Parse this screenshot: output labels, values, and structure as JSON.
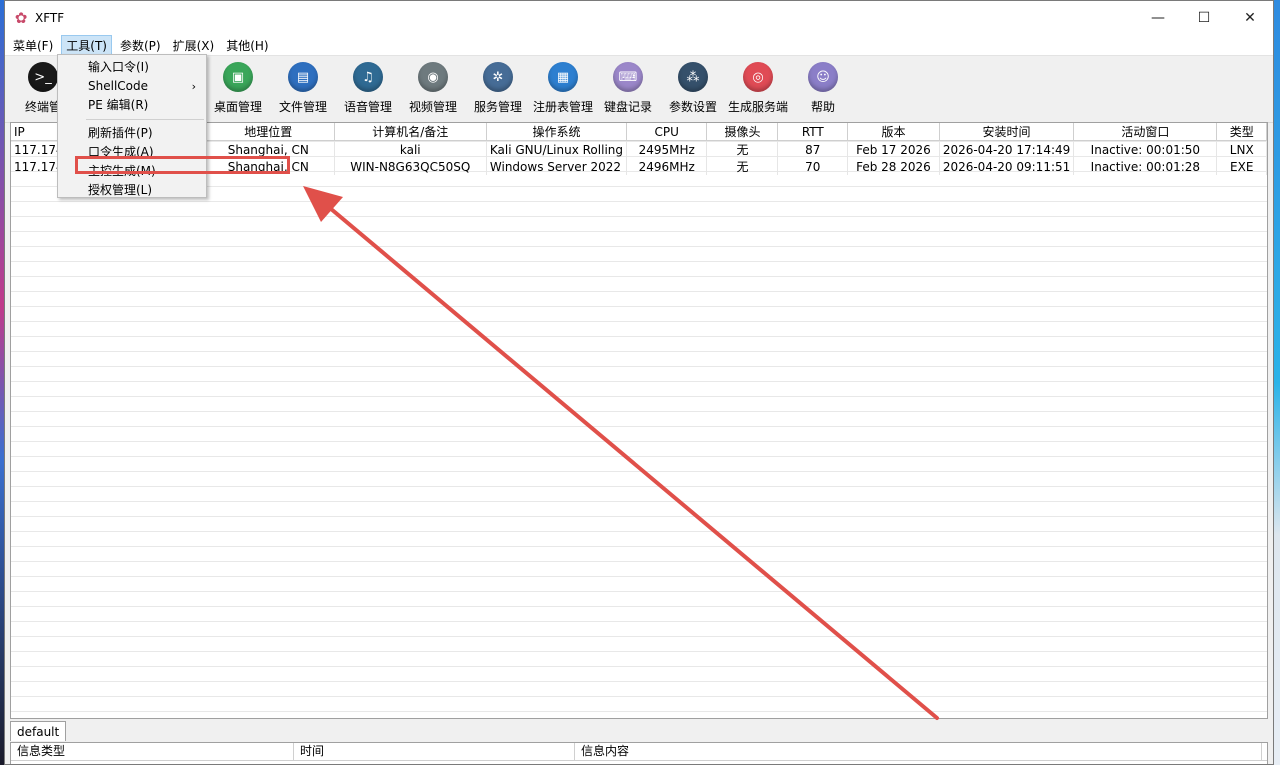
{
  "window": {
    "title": "XFTF",
    "controls": [
      "—",
      "☐",
      "✕"
    ]
  },
  "menubar": [
    "菜单(F)",
    "工具(T)",
    "参数(P)",
    "扩展(X)",
    "其他(H)"
  ],
  "toolbar": [
    {
      "label": "终端管",
      "icon": "terminal-icon",
      "color": "#1a1a1a",
      "glyph": ">_"
    },
    {
      "label": "桌面管理",
      "icon": "desktop-icon",
      "color": "#3aa65a",
      "glyph": "▣"
    },
    {
      "label": "文件管理",
      "icon": "file-icon",
      "color": "#2e6fbf",
      "glyph": "▤"
    },
    {
      "label": "语音管理",
      "icon": "audio-icon",
      "color": "#2f6a93",
      "glyph": "♫"
    },
    {
      "label": "视频管理",
      "icon": "camera-icon",
      "color": "#6e7a7e",
      "glyph": "◉"
    },
    {
      "label": "服务管理",
      "icon": "gear-icon",
      "color": "#466c96",
      "glyph": "✲"
    },
    {
      "label": "注册表管理",
      "icon": "registry-icon",
      "color": "#2d7fd0",
      "glyph": "▦"
    },
    {
      "label": "键盘记录",
      "icon": "keyboard-icon",
      "color": "#9b87c9",
      "glyph": "⌨"
    },
    {
      "label": "参数设置",
      "icon": "settings-icon",
      "color": "#35506b",
      "glyph": "⁂"
    },
    {
      "label": "生成服务端",
      "icon": "build-icon",
      "color": "#e04b55",
      "glyph": "◎"
    },
    {
      "label": "帮助",
      "icon": "help-icon",
      "color": "#8b7ec8",
      "glyph": "☺"
    }
  ],
  "tools_menu": {
    "items": [
      "输入口令(I)",
      "ShellCode",
      "PE 编辑(R)",
      "刷新插件(P)",
      "口令生成(A)",
      "主控生成(M)",
      "授权管理(L)"
    ]
  },
  "table": {
    "columns": [
      "IP",
      "",
      "",
      "地理位置",
      "计算机名/备注",
      "操作系统",
      "CPU",
      "摄像头",
      "RTT",
      "版本",
      "安装时间",
      "活动窗口",
      "类型"
    ],
    "rows": [
      [
        "117.174",
        "",
        "",
        "Shanghai, CN",
        "kali",
        "Kali GNU/Linux Rolling",
        "2495MHz",
        "无",
        "87",
        "Feb 17 2026",
        "2026-04-20 17:14:49",
        "Inactive: 00:01:50",
        "LNX"
      ],
      [
        "117.174",
        "",
        "",
        "Shanghai, CN",
        "WIN-N8G63QC50SQ",
        "Windows Server 2022",
        "2496MHz",
        "无",
        "70",
        "Feb 28 2026",
        "2026-04-20 09:11:51",
        "Inactive: 00:01:28",
        "EXE"
      ]
    ]
  },
  "tabs": [
    "default"
  ],
  "log": {
    "columns": [
      "信息类型",
      "时间",
      "信息内容"
    ]
  },
  "colors": {
    "annotation": "#e0504a",
    "menu_highlight": "#cce4f7"
  }
}
